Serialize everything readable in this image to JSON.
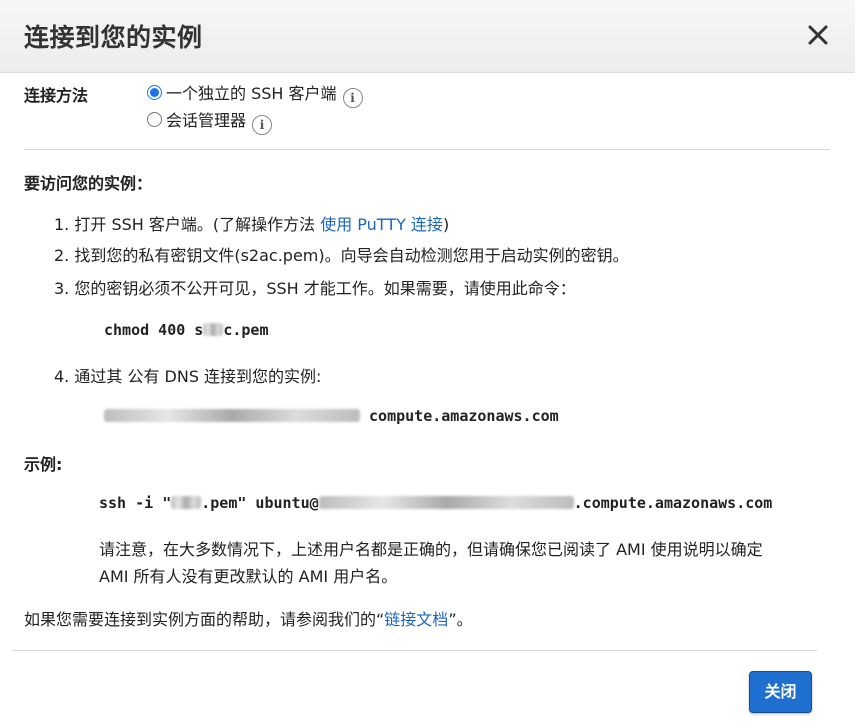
{
  "dialog": {
    "title": "连接到您的实例",
    "close_button_label": "关闭"
  },
  "connection_method": {
    "label": "连接方法",
    "options": [
      {
        "label": "一个独立的 SSH 客户端",
        "selected": true
      },
      {
        "label": "会话管理器",
        "selected": false
      }
    ]
  },
  "access": {
    "heading": "要访问您的实例：",
    "step1_prefix": "1. 打开 SSH 客户端。(了解操作方法 ",
    "step1_link": "使用 PuTTY 连接",
    "step1_suffix": ")",
    "step2": "2. 找到您的私有密钥文件(s2ac.pem)。向导会自动检测您用于启动实例的密钥。",
    "step3": "3. 您的密钥必须不公开可见，SSH 才能工作。如果需要，请使用此命令：",
    "chmod_prefix": "chmod 400 s",
    "chmod_suffix": "c.pem",
    "step4": "4. 通过其 公有 DNS 连接到您的实例:",
    "dns_suffix": "compute.amazonaws.com"
  },
  "example": {
    "heading": "示例:",
    "cmd_prefix": "ssh -i \"",
    "cmd_mid": ".pem\" ubuntu@",
    "cmd_suffix": ".compute.amazonaws.com",
    "note_line1": "请注意，在大多数情况下，上述用户名都是正确的，但请确保您已阅读了 AMI 使用说明以确定",
    "note_line2": "AMI 所有人没有更改默认的 AMI 用户名。"
  },
  "help": {
    "prefix": "如果您需要连接到实例方面的帮助，请参阅我们的“",
    "link": "链接文档",
    "suffix": "”。"
  },
  "colors": {
    "accent": "#1f6fd0",
    "link": "#1a66c2"
  }
}
